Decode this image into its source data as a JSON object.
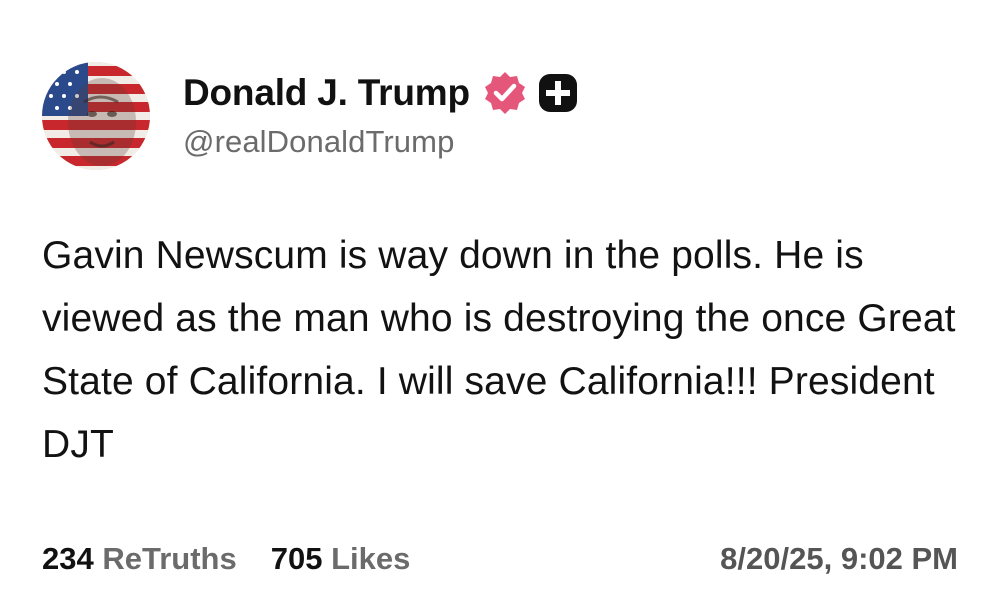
{
  "author": {
    "display_name": "Donald J. Trump",
    "handle": "@realDonaldTrump",
    "avatar_icon": "avatar-flag-portrait",
    "verified_icon": "verified-badge-icon",
    "verified_color": "#e5577a",
    "platform_icon": "plus-icon"
  },
  "post": {
    "text": "Gavin Newscum is way down in the polls. He is viewed as the man who is destroying the once Great State of California. I will save California!!! President DJT"
  },
  "stats": {
    "retruths_count": "234",
    "retruths_label": "ReTruths",
    "likes_count": "705",
    "likes_label": "Likes",
    "timestamp": "8/20/25, 9:02 PM"
  }
}
